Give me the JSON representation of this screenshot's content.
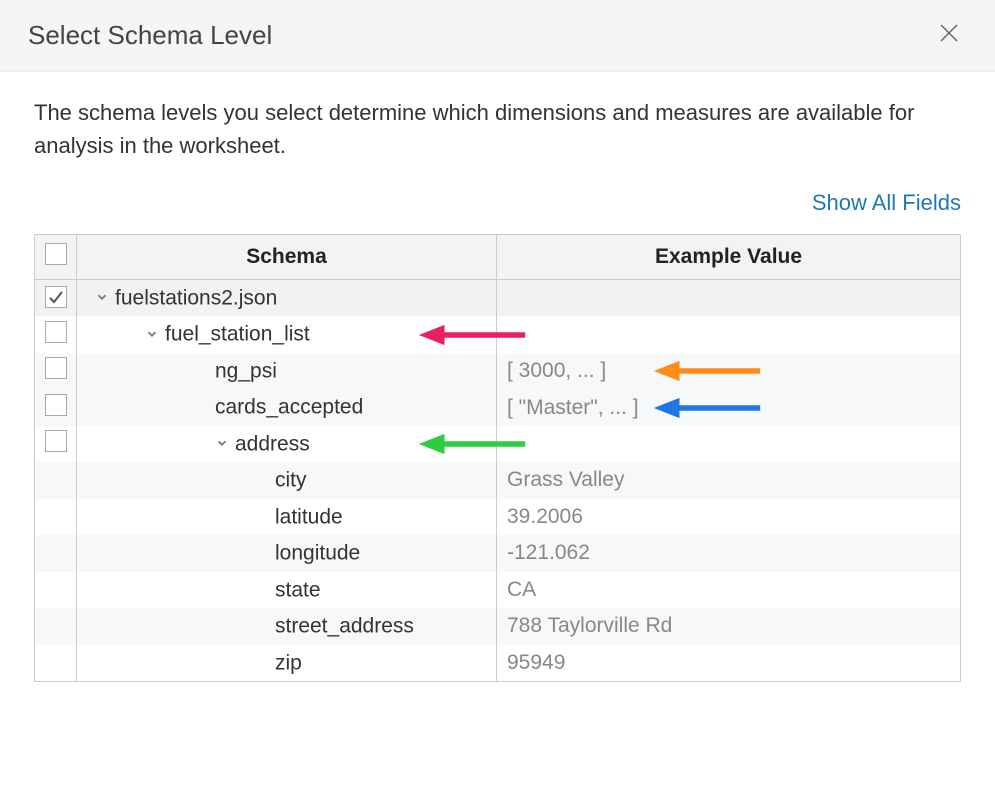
{
  "header": {
    "title": "Select Schema Level"
  },
  "description": "The schema levels you select determine which dimensions and measures are available for analysis in the worksheet.",
  "actions": {
    "show_all_fields": "Show All Fields"
  },
  "table": {
    "columns": {
      "schema": "Schema",
      "example": "Example Value"
    },
    "rows": [
      {
        "label": "fuelstations2.json",
        "value": "",
        "indent": 0,
        "expandable": true,
        "checkbox": true,
        "checked": true,
        "shade": "shade"
      },
      {
        "label": "fuel_station_list",
        "value": "",
        "indent": 1,
        "expandable": true,
        "checkbox": true,
        "checked": false,
        "shade": "",
        "arrow_color": "#e91e63",
        "arrow_side": "schema"
      },
      {
        "label": "ng_psi",
        "value": "[ 3000, ... ]",
        "indent": 2,
        "expandable": false,
        "checkbox": true,
        "checked": false,
        "shade": "shade-light",
        "arrow_color": "#ff8c1a",
        "arrow_side": "value"
      },
      {
        "label": "cards_accepted",
        "value": "[ \"Master\", ... ]",
        "indent": 2,
        "expandable": false,
        "checkbox": true,
        "checked": false,
        "shade": "shade-light",
        "arrow_color": "#1f77e6",
        "arrow_side": "value"
      },
      {
        "label": "address",
        "value": "",
        "indent": 2,
        "expandable": true,
        "checkbox": true,
        "checked": false,
        "shade": "",
        "arrow_color": "#2ecc40",
        "arrow_side": "schema"
      },
      {
        "label": "city",
        "value": "Grass Valley",
        "indent": 3,
        "expandable": false,
        "checkbox": false,
        "shade": "shade-light"
      },
      {
        "label": "latitude",
        "value": "39.2006",
        "indent": 3,
        "expandable": false,
        "checkbox": false,
        "shade": ""
      },
      {
        "label": "longitude",
        "value": "-121.062",
        "indent": 3,
        "expandable": false,
        "checkbox": false,
        "shade": "shade-light"
      },
      {
        "label": "state",
        "value": "CA",
        "indent": 3,
        "expandable": false,
        "checkbox": false,
        "shade": ""
      },
      {
        "label": "street_address",
        "value": "788 Taylorville Rd",
        "indent": 3,
        "expandable": false,
        "checkbox": false,
        "shade": "shade-light"
      },
      {
        "label": "zip",
        "value": "95949",
        "indent": 3,
        "expandable": false,
        "checkbox": false,
        "shade": ""
      }
    ]
  }
}
